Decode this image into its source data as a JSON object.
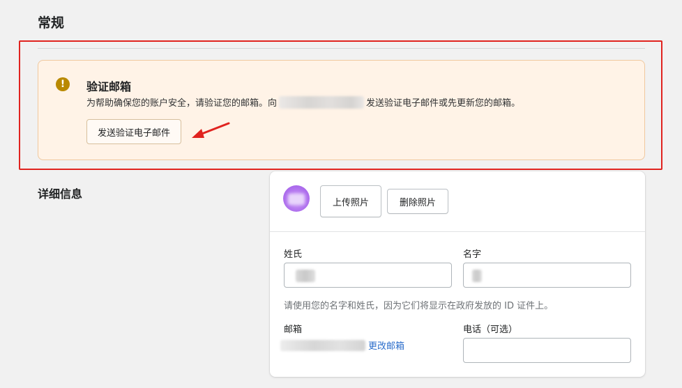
{
  "page": {
    "section_title": "常规"
  },
  "banner": {
    "icon": "warning-icon",
    "icon_glyph": "!",
    "title": "验证邮箱",
    "desc_before": "为帮助确保您的账户安全，请验证您的邮箱。向",
    "desc_after": "发送验证电子邮件或先更新您的邮箱。",
    "button_label": "发送验证电子邮件"
  },
  "details": {
    "section_title": "详细信息",
    "upload_label": "上传照片",
    "delete_label": "删除照片",
    "last_name_label": "姓氏",
    "first_name_label": "名字",
    "hint": "请使用您的名字和姓氏，因为它们将显示在政府发放的 ID 证件上。",
    "email_label": "邮箱",
    "change_email_label": "更改邮箱",
    "phone_label": "电话（可选）"
  },
  "colors": {
    "annotation": "#e0231f",
    "banner_bg": "#fff3e7",
    "warning": "#b98900",
    "link": "#2c6ecb"
  }
}
